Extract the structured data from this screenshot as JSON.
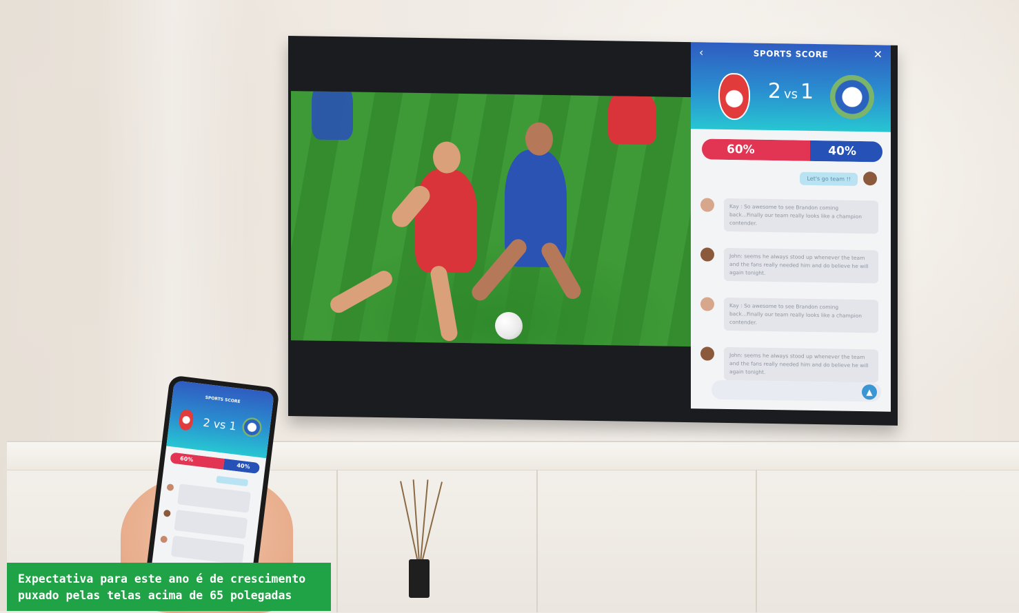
{
  "tv_panel": {
    "title": "SPORTS SCORE",
    "home_score": "2",
    "vs_label": "vs",
    "away_score": "1",
    "home_possession": "60%",
    "away_possession": "40%",
    "my_message": "Let's go team !!",
    "messages": [
      {
        "text": "Kay : So awesome to see Brandon coming back...Finally our team really looks like a champion contender."
      },
      {
        "text": "John: seems he always stood up whenever the team and the fans really needed him and do believe he will again tonight."
      },
      {
        "text": "Kay : So awesome to see Brandon coming back...Finally our team really looks like a champion contender."
      },
      {
        "text": "John: seems he always stood up whenever the team and the fans really needed him and do believe he will again tonight."
      }
    ]
  },
  "phone_panel": {
    "title": "SPORTS SCORE",
    "score": "2 vs 1",
    "home_possession": "60%",
    "away_possession": "40%"
  },
  "caption": {
    "line1": "Expectativa para este ano é de crescimento",
    "line2": "puxado pelas telas acima de 65 polegadas"
  },
  "colors": {
    "panel_gradient_top": "#2f5cc1",
    "panel_gradient_bottom": "#27c6d2",
    "home_team": "#e23553",
    "away_team": "#2652b8",
    "caption_bg": "#1fa346"
  }
}
